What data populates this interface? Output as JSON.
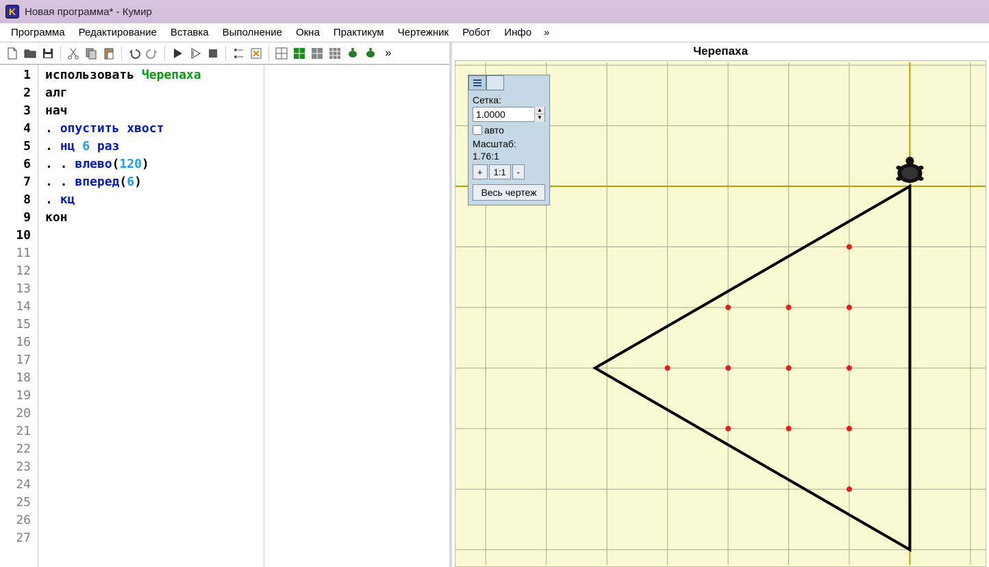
{
  "window": {
    "title": "Новая программа* - Кумир",
    "app_letter": "K"
  },
  "menu": {
    "items": [
      "Программа",
      "Редактирование",
      "Вставка",
      "Выполнение",
      "Окна",
      "Практикум",
      "Чертежник",
      "Робот",
      "Инфо"
    ],
    "more": "»"
  },
  "toolbar": {
    "more": "»"
  },
  "editor": {
    "visible_first_line": 1,
    "visible_last_line": 27,
    "active_lines": 10,
    "code_lines": [
      {
        "tokens": [
          {
            "t": "использовать ",
            "c": "kw"
          },
          {
            "t": "Черепаха",
            "c": "lib"
          }
        ]
      },
      {
        "tokens": [
          {
            "t": "алг",
            "c": "kw"
          }
        ]
      },
      {
        "tokens": [
          {
            "t": "нач",
            "c": "kw"
          }
        ]
      },
      {
        "tokens": [
          {
            "t": ". ",
            "c": "dot"
          },
          {
            "t": "опустить хвост",
            "c": "fn"
          }
        ]
      },
      {
        "tokens": [
          {
            "t": ". ",
            "c": "dot"
          },
          {
            "t": "нц ",
            "c": "fn"
          },
          {
            "t": "6",
            "c": "num"
          },
          {
            "t": " раз",
            "c": "fn"
          }
        ]
      },
      {
        "tokens": [
          {
            "t": ". . ",
            "c": "dot"
          },
          {
            "t": "влево",
            "c": "fn"
          },
          {
            "t": "(",
            "c": "kw"
          },
          {
            "t": "120",
            "c": "num"
          },
          {
            "t": ")",
            "c": "kw"
          }
        ]
      },
      {
        "tokens": [
          {
            "t": ". . ",
            "c": "dot"
          },
          {
            "t": "вперед",
            "c": "fn"
          },
          {
            "t": "(",
            "c": "kw"
          },
          {
            "t": "6",
            "c": "num"
          },
          {
            "t": ")",
            "c": "kw"
          }
        ]
      },
      {
        "tokens": [
          {
            "t": ". ",
            "c": "dot"
          },
          {
            "t": "кц",
            "c": "fn"
          }
        ]
      },
      {
        "tokens": [
          {
            "t": "кон",
            "c": "kw"
          }
        ]
      }
    ]
  },
  "right": {
    "title": "Черепаха",
    "panel": {
      "grid_label": "Сетка:",
      "grid_value": "1.0000",
      "auto_label": "авто",
      "auto_checked": false,
      "scale_label": "Масштаб:",
      "scale_value": "1.76:1",
      "plus": "+",
      "one": "1:1",
      "minus": "-",
      "fit": "Весь чертеж"
    }
  },
  "chart_data": {
    "type": "scatter",
    "description": "Turtle canvas showing an equilateral triangle traced twice and red integer grid points inside/near it",
    "grid_step": 1.0,
    "origin_note": "origin at turtle start (top-right vertex), y up",
    "triangle_vertices": [
      {
        "x": 0,
        "y": 0
      },
      {
        "x": -5.196,
        "y": -3
      },
      {
        "x": 0,
        "y": -6
      }
    ],
    "red_points": [
      {
        "x": -4,
        "y": -3
      },
      {
        "x": -3,
        "y": -3
      },
      {
        "x": -2,
        "y": -3
      },
      {
        "x": -1,
        "y": -3
      },
      {
        "x": -3,
        "y": -2
      },
      {
        "x": -2,
        "y": -2
      },
      {
        "x": -1,
        "y": -2
      },
      {
        "x": -3,
        "y": -4
      },
      {
        "x": -2,
        "y": -4
      },
      {
        "x": -1,
        "y": -4
      },
      {
        "x": -1,
        "y": -1
      },
      {
        "x": -1,
        "y": -5
      }
    ],
    "turtle_position": {
      "x": 0,
      "y": 0
    },
    "x_range_visible_cells": [
      -8,
      1
    ],
    "y_range_visible_cells": [
      -7,
      2
    ]
  }
}
